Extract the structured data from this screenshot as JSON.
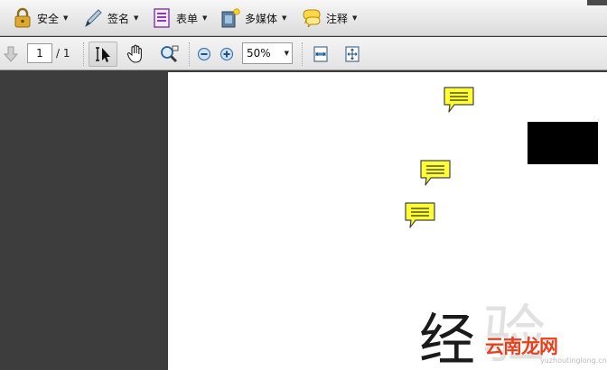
{
  "menubar": {
    "items": [
      {
        "label": "安全",
        "icon": "lock-icon"
      },
      {
        "label": "签名",
        "icon": "pen-icon"
      },
      {
        "label": "表单",
        "icon": "form-icon"
      },
      {
        "label": "多媒体",
        "icon": "film-icon"
      },
      {
        "label": "注释",
        "icon": "comment-icon"
      }
    ]
  },
  "toolbar": {
    "page_current": "1",
    "page_total": "/ 1",
    "zoom": "50%",
    "icons": [
      "next-page-icon",
      "select-cursor-icon",
      "hand-tool-icon",
      "zoom-tool-icon",
      "zoom-out-icon",
      "zoom-in-icon",
      "fit-width-icon",
      "fit-page-icon"
    ]
  },
  "document": {
    "sticky_notes": 3,
    "big_text": "经",
    "ghost_text": "验",
    "watermark": "云南龙网",
    "watermark_url": "yuzhoutinglong.cn"
  },
  "colors": {
    "note_fill": "#ffff33",
    "watermark": "#e8401c",
    "workspace": "#3b3b3c"
  }
}
